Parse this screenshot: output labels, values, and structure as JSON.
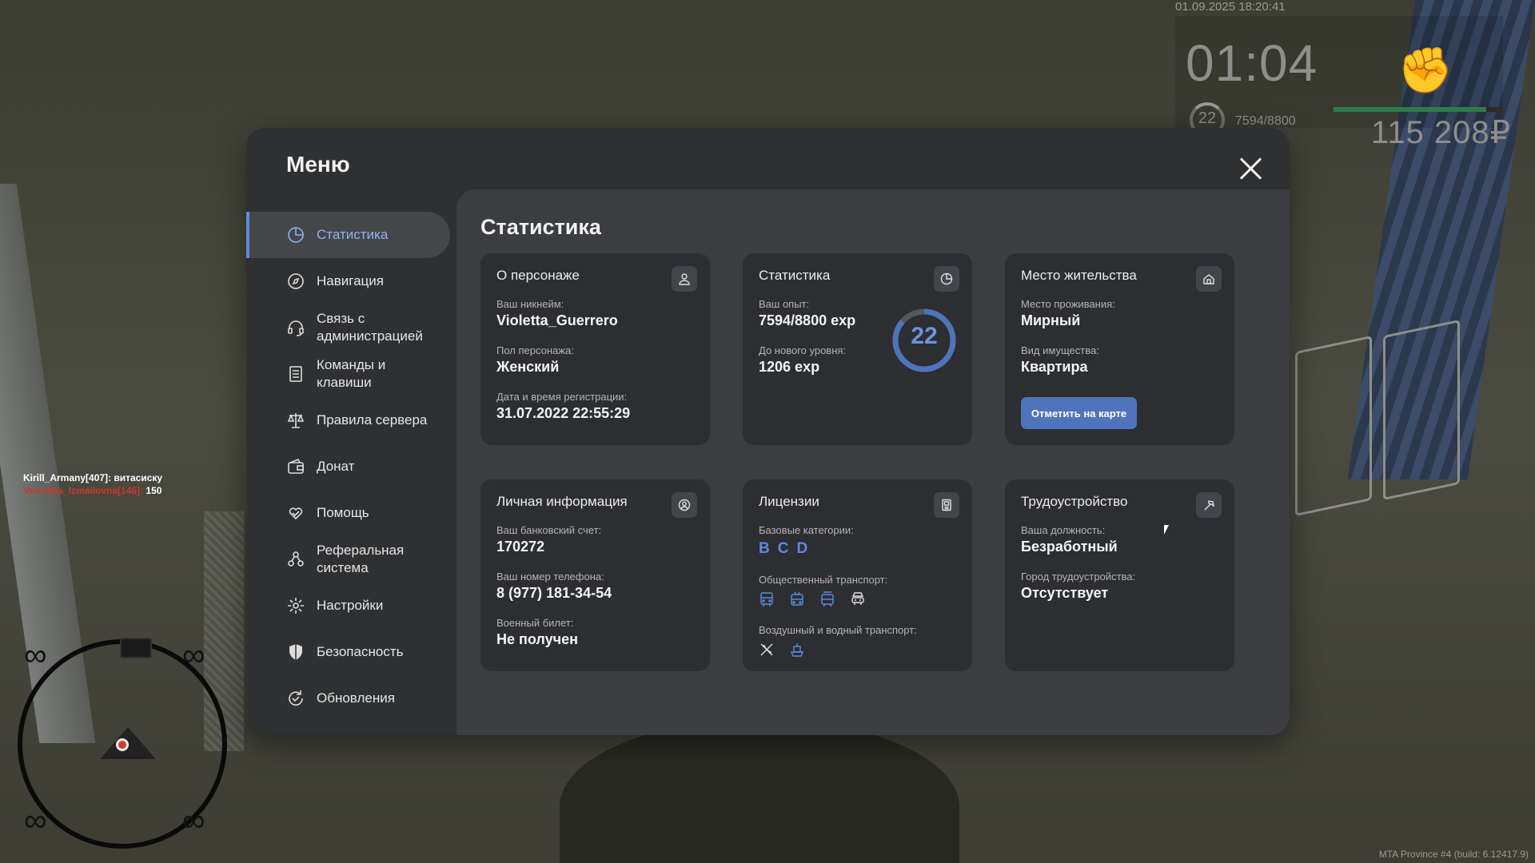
{
  "hud": {
    "datetime": "01.09.2025 18:20:41",
    "clock": "01:04",
    "level": "22",
    "xp": "7594/8800",
    "money": "115 208₽",
    "health_fraction": 0.9,
    "fist_icon": "fist-icon"
  },
  "chat": [
    {
      "name": "Kirill_Armany[407]:",
      "text": " витасиску"
    },
    {
      "name": "Veronika_Izmailovna[146]:",
      "text": " 150"
    }
  ],
  "build_info": "MTA Province #4 (build: 6.12417.9)",
  "menu": {
    "title": "Меню",
    "items": [
      {
        "label": "Статистика",
        "icon": "chart-pie-icon"
      },
      {
        "label": "Навигация",
        "icon": "compass-icon"
      },
      {
        "label": "Связь с администрацией",
        "icon": "headset-icon"
      },
      {
        "label": "Команды и клавиши",
        "icon": "document-icon"
      },
      {
        "label": "Правила сервера",
        "icon": "scales-icon"
      },
      {
        "label": "Донат",
        "icon": "wallet-icon"
      },
      {
        "label": "Помощь",
        "icon": "heart-hand-icon"
      },
      {
        "label": "Реферальная система",
        "icon": "people-icon"
      },
      {
        "label": "Настройки",
        "icon": "gear-icon"
      },
      {
        "label": "Безопасность",
        "icon": "shield-icon"
      },
      {
        "label": "Обновления",
        "icon": "refresh-icon"
      }
    ]
  },
  "stats": {
    "title": "Статистика",
    "about": {
      "title": "О персонаже",
      "nick_label": "Ваш никнейм:",
      "nick": "Violetta_Guerrero",
      "gender_label": "Пол персонажа:",
      "gender": "Женский",
      "reg_label": "Дата и время регистрации:",
      "reg": "31.07.2022 22:55:29"
    },
    "statistics": {
      "title": "Статистика",
      "exp_label": "Ваш опыт:",
      "exp": "7594/8800 exp",
      "next_label": "До нового уровня:",
      "next": "1206 exp",
      "level": "22",
      "progress": 0.863
    },
    "residence": {
      "title": "Место жительства",
      "place_label": "Место проживания:",
      "place": "Мирный",
      "property_label": "Вид имущества:",
      "property": "Квартира",
      "button": "Отметить на карте"
    },
    "personal": {
      "title": "Личная информация",
      "bank_label": "Ваш банковский счет:",
      "bank": "170272",
      "phone_label": "Ваш номер телефона:",
      "phone": "8 (977) 181-34-54",
      "military_label": "Военный билет:",
      "military": "Не получен"
    },
    "licenses": {
      "title": "Лицензии",
      "base_label": "Базовые категории:",
      "base": [
        "B",
        "C",
        "D"
      ],
      "public_label": "Общественный транспорт:",
      "public_icons": [
        "bus-icon",
        "trolleybus-icon",
        "tram-icon",
        "taxi-icon"
      ],
      "air_label": "Воздушный и водный транспорт:",
      "air_icons": [
        "plane-icon",
        "boat-icon"
      ]
    },
    "employment": {
      "title": "Трудоустройство",
      "position_label": "Ваша должность:",
      "position": "Безработный",
      "city_label": "Город трудоустройства:",
      "city": "Отсутствует"
    }
  },
  "colors": {
    "accent": "#5b8be3",
    "button": "#4f74bc",
    "panel": "#2f3032",
    "card": "#2d2e31"
  }
}
